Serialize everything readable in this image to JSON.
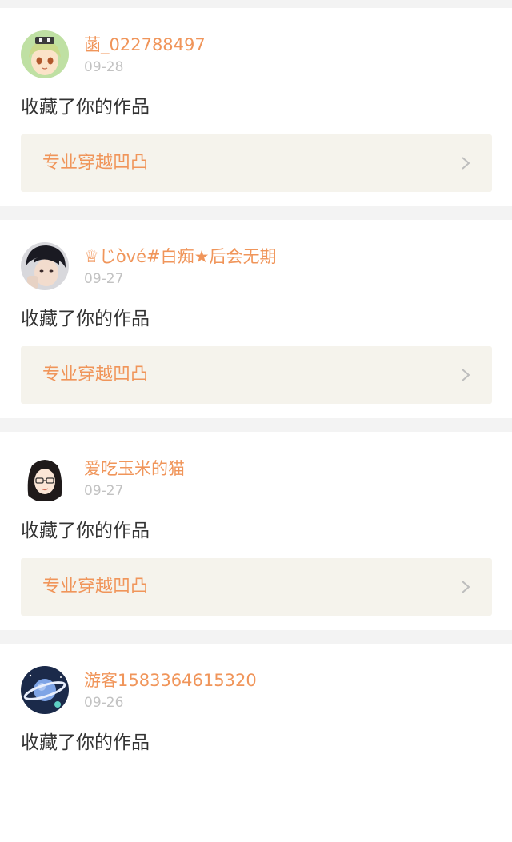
{
  "feed": {
    "items": [
      {
        "username": "菡_022788497",
        "date": "09-28",
        "action": "收藏了你的作品",
        "work_title": "专业穿越凹凸",
        "avatar_icon": "anime-girl-avatar",
        "avatar_bg": "#bfe0a3"
      },
      {
        "username": "♕じòvé#白痴★后会无期",
        "date": "09-27",
        "action": "收藏了你的作品",
        "work_title": "专业穿越凹凸",
        "avatar_icon": "person-photo-avatar",
        "avatar_bg": "#d8d8dc"
      },
      {
        "username": "爱吃玉米的猫",
        "date": "09-27",
        "action": "收藏了你的作品",
        "work_title": "专业穿越凹凸",
        "avatar_icon": "cartoon-woman-glasses-avatar",
        "avatar_bg": "#ffffff"
      },
      {
        "username": "游客1583364615320",
        "date": "09-26",
        "action": "收藏了你的作品",
        "work_title": "",
        "avatar_icon": "planet-avatar",
        "avatar_bg": "#1b2a4a"
      }
    ]
  },
  "colors": {
    "accent": "#f0955a",
    "date": "#c2c2c2",
    "text": "#333333",
    "link_bg": "#f5f3ec",
    "page_bg": "#f3f3f3",
    "card_bg": "#ffffff"
  }
}
